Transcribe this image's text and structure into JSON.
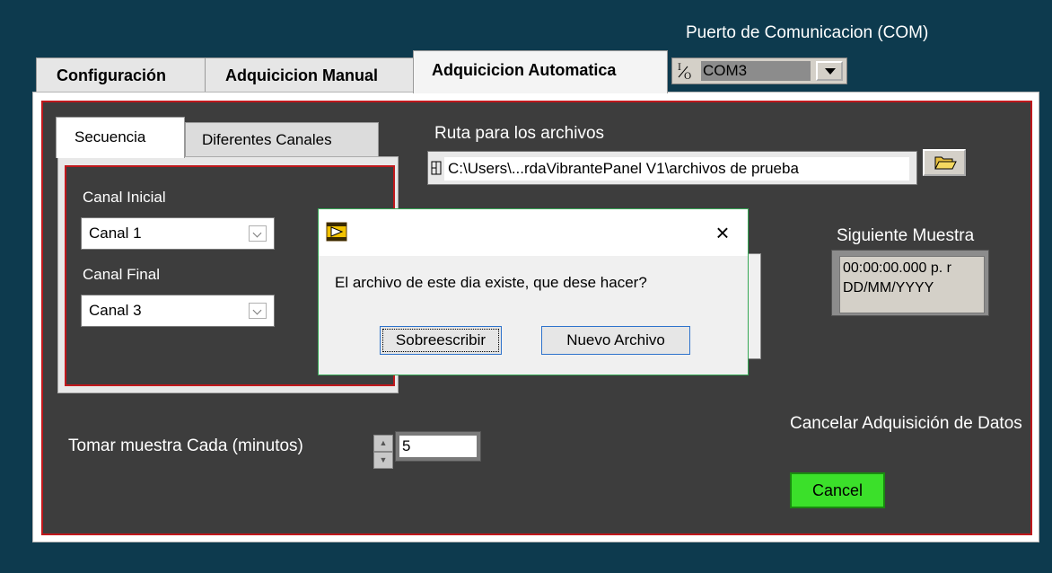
{
  "com": {
    "label": "Puerto de Comunicacion (COM)",
    "io_marker": "I/O",
    "value": "COM3"
  },
  "main_tabs": [
    {
      "label": "Configuración"
    },
    {
      "label": "Adquicicion Manual"
    },
    {
      "label": "Adquicicion Automatica",
      "selected": true
    }
  ],
  "sub_tabs": [
    {
      "label": "Secuencia",
      "selected": true
    },
    {
      "label": "Diferentes Canales"
    }
  ],
  "secuencia": {
    "canal_inicial_label": "Canal Inicial",
    "canal_inicial_value": "Canal 1",
    "canal_final_label": "Canal Final",
    "canal_final_value": "Canal 3"
  },
  "ruta": {
    "label": "Ruta para los archivos",
    "value": "C:\\Users\\...rdaVibrantePanel V1\\archivos de prueba"
  },
  "siguiente": {
    "label": "Siguiente Muestra",
    "time": "00:00:00.000 p. r",
    "date": "DD/MM/YYYY"
  },
  "tomar": {
    "label": "Tomar muestra Cada (minutos)",
    "value": "5"
  },
  "cancel": {
    "label": "Cancelar Adquisición de Datos",
    "button": "Cancel",
    "color": "#3be02a"
  },
  "dialog": {
    "message": "El archivo de este dia existe, que dese hacer?",
    "buttons": [
      {
        "label": "Sobreescribir"
      },
      {
        "label": "Nuevo Archivo"
      }
    ],
    "close_glyph": "×"
  },
  "colors": {
    "background": "#0d3a4e",
    "panel": "#3d3d3d",
    "border_accent": "#c0181c"
  }
}
